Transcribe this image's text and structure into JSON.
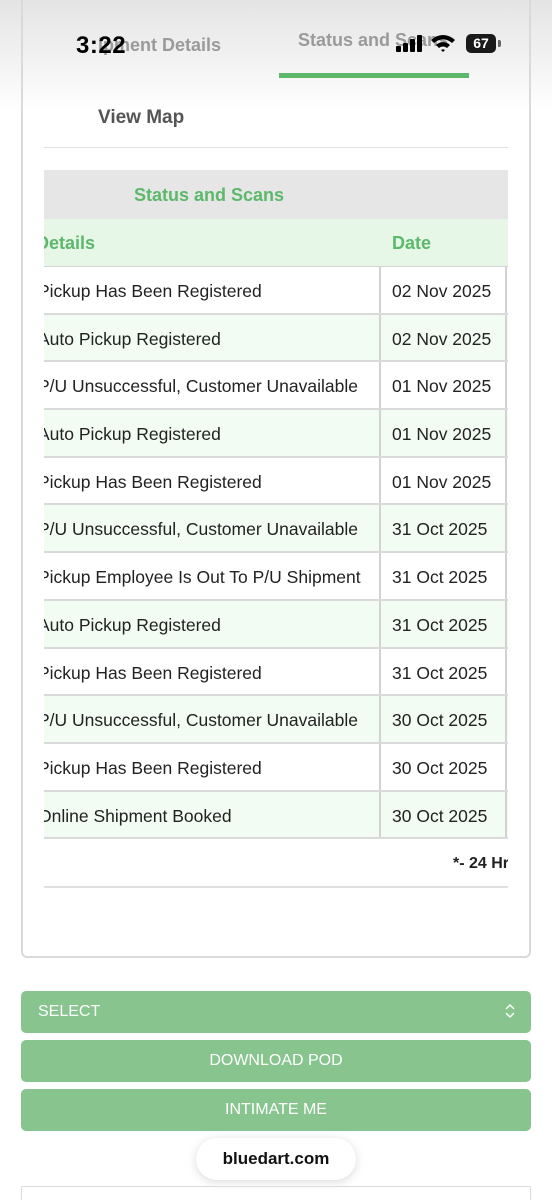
{
  "status_bar": {
    "time": "3:22",
    "battery": "67"
  },
  "tabs": [
    {
      "label": "Shipment Details",
      "visible_text": "ipment Details"
    },
    {
      "label": "Status and Scans",
      "visible_text": "Status and Scans"
    }
  ],
  "view_map": {
    "label": "View Map"
  },
  "status_table": {
    "title": "Status and Scans",
    "columns": [
      "Details",
      "Date"
    ],
    "rows": [
      {
        "details": "Pickup Has Been Registered",
        "date": "02 Nov 2025"
      },
      {
        "details": "Auto Pickup Registered",
        "date": "02 Nov 2025"
      },
      {
        "details": "P/U Unsuccessful, Customer Unavailable",
        "date": "01 Nov 2025"
      },
      {
        "details": "Auto Pickup Registered",
        "date": "01 Nov 2025"
      },
      {
        "details": "Pickup Has Been Registered",
        "date": "01 Nov 2025"
      },
      {
        "details": "P/U Unsuccessful, Customer Unavailable",
        "date": "31 Oct 2025"
      },
      {
        "details": "Pickup Employee Is Out To P/U Shipment",
        "date": "31 Oct 2025"
      },
      {
        "details": "Auto Pickup Registered",
        "date": "31 Oct 2025"
      },
      {
        "details": "Pickup Has Been Registered",
        "date": "31 Oct 2025"
      },
      {
        "details": "P/U Unsuccessful, Customer Unavailable",
        "date": "30 Oct 2025"
      },
      {
        "details": "Pickup Has Been Registered",
        "date": "30 Oct 2025"
      },
      {
        "details": "Online Shipment Booked",
        "date": "30 Oct 2025"
      }
    ],
    "footnote": "*- 24 Hr"
  },
  "controls": {
    "select": {
      "label": "SELECT"
    },
    "download_pod": "DOWNLOAD POD",
    "intimate_me": "INTIMATE ME"
  },
  "browser": {
    "url": "bluedart.com"
  },
  "colors": {
    "accent_green": "#5cb86b",
    "button_green": "#87c48e",
    "row_tint": "#f2fcf3",
    "header_gray": "#e6e6e6"
  }
}
